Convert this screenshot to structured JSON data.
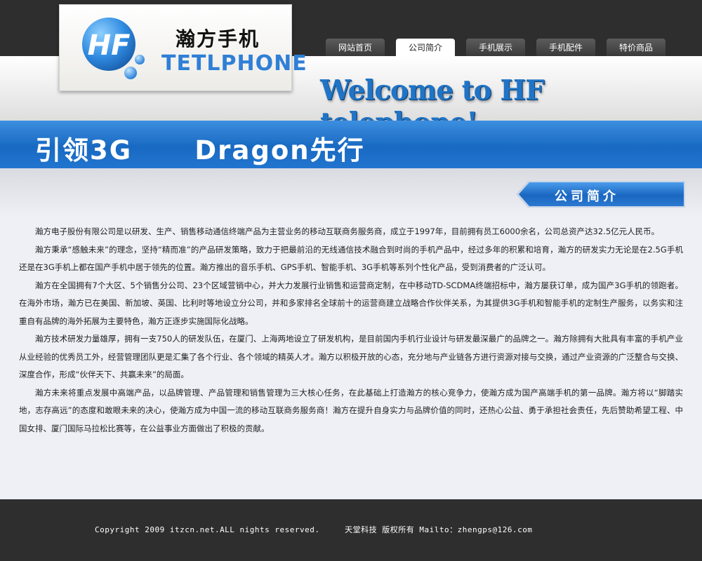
{
  "logo": {
    "emblem_text": "HF",
    "cn_name": "瀚方手机",
    "en_name": "TETLPHONE"
  },
  "nav": {
    "items": [
      {
        "label": "网站首页",
        "active": false
      },
      {
        "label": "公司简介",
        "active": true
      },
      {
        "label": "手机展示",
        "active": false
      },
      {
        "label": "手机配件",
        "active": false
      },
      {
        "label": "特价商品",
        "active": false
      }
    ]
  },
  "header": {
    "welcome": "Welcome to HF telephone!"
  },
  "banner": {
    "slogan": "引领3G      Dragon先行"
  },
  "section": {
    "title": "公司简介"
  },
  "article": {
    "paragraphs": [
      "瀚方电子股份有限公司是以研发、生产、销售移动通信终端产品为主营业务的移动互联商务服务商，成立于1997年，目前拥有员工6000余名，公司总资产达32.5亿元人民币。",
      "瀚方秉承“感触未来”的理念，坚持“精而准”的产品研发策略，致力于把最前沿的无线通信技术融合到时尚的手机产品中，经过多年的积累和培育，瀚方的研发实力无论是在2.5G手机还是在3G手机上都在国产手机中居于领先的位置。瀚方推出的音乐手机、GPS手机、智能手机、3G手机等系列个性化产品，受到消费者的广泛认可。",
      "瀚方在全国拥有7个大区、5个销售分公司、23个区域营销中心，并大力发展行业销售和运营商定制，在中移动TD-SCDMA终端招标中，瀚方屡获订单，成为国产3G手机的领跑者。在海外市场，瀚方已在美国、新加坡、英国、比利时等地设立分公司，并和多家排名全球前十的运营商建立战略合作伙伴关系，为其提供3G手机和智能手机的定制生产服务，以务实和注重自有品牌的海外拓展为主要特色，瀚方正逐步实施国际化战略。",
      "瀚方技术研发力量雄厚，拥有一支750人的研发队伍，在厦门、上海两地设立了研发机构，是目前国内手机行业设计与研发最深最广的品牌之一。瀚方除拥有大批具有丰富的手机产业从业经验的优秀员工外，经营管理团队更是汇集了各个行业、各个领域的精英人才。瀚方以积极开放的心态，充分地与产业链各方进行资源对接与交换，通过产业资源的广泛整合与交换、深度合作，形成“伙伴天下、共赢未来”的局面。",
      "瀚方未来将重点发展中高端产品，以品牌管理、产品管理和销售管理为三大核心任务，在此基础上打造瀚方的核心竞争力，使瀚方成为国产高端手机的第一品牌。瀚方将以“脚踏实地，志存高远”的态度和敢眼未来的决心，使瀚方成为中国一流的移动互联商务服务商！瀚方在提升自身实力与品牌价值的同时，还热心公益、勇于承担社会责任，先后赞助希望工程、中国女排、厦门国际马拉松比赛等，在公益事业方面做出了积极的贡献。"
    ]
  },
  "footer": {
    "text": "Copyright 2009 itzcn.net.ALL nights reserved.     天堂科技 版权所有 Mailto：zhengps@126.com"
  },
  "colors": {
    "brand_blue": "#1f74c6",
    "banner_blue": "#1869c2",
    "dark_bar": "#2e2e2e"
  }
}
